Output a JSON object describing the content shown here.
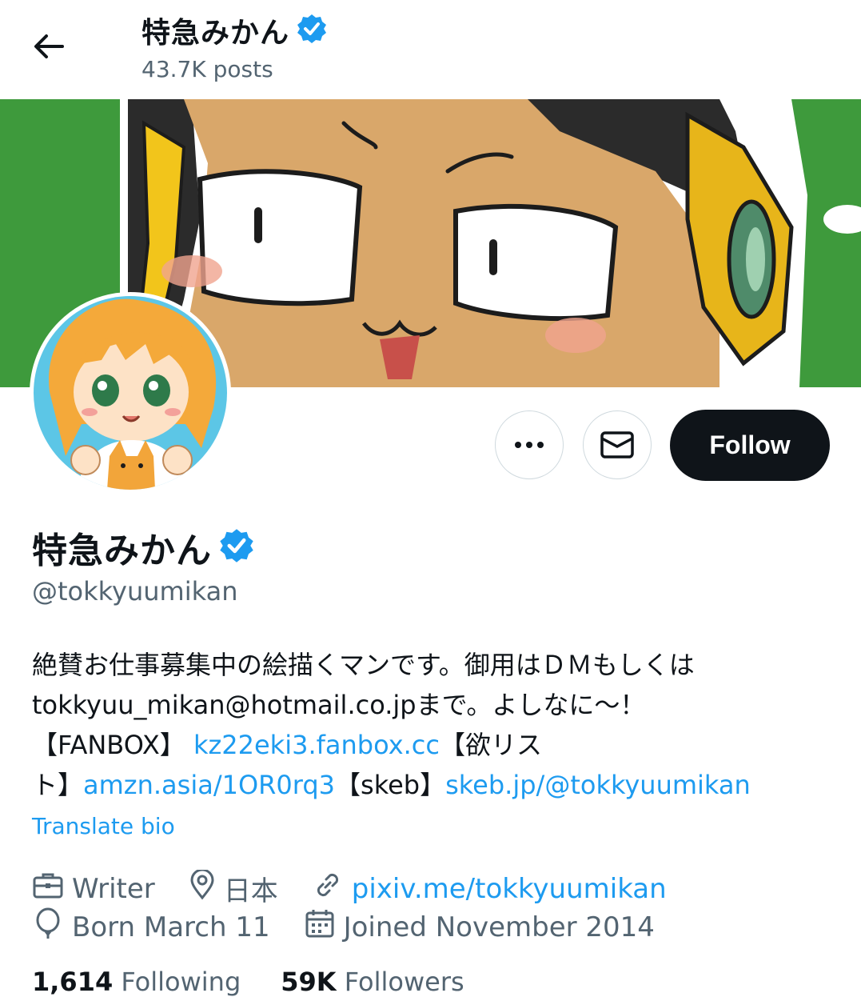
{
  "header": {
    "title": "特急みかん",
    "posts": "43.7K posts"
  },
  "actions": {
    "follow_label": "Follow"
  },
  "profile": {
    "name": "特急みかん",
    "handle": "@tokkyuumikan",
    "bio": {
      "line1": "絶賛お仕事募集中の絵描くマンです。御用はＤＭもしくは",
      "line2": "tokkyuu_mikan@hotmail.co.jpまで。よしなに～！",
      "fanbox_prefix": "【FANBOX】 ",
      "fanbox_link": "kz22eki3.fanbox.cc",
      "wishlist_prefix": "【欲リス",
      "wishlist_cont": "ト】",
      "wishlist_link": "amzn.asia/1OR0rq3",
      "skeb_prefix": "【skeb】",
      "skeb_link": "skeb.jp/@tokkyuumikan"
    },
    "translate_label": "Translate bio",
    "meta": {
      "category": "Writer",
      "location": "日本",
      "website": "pixiv.me/tokkyuumikan",
      "birthday": "Born March 11",
      "joined": "Joined November 2014"
    },
    "stats": {
      "following_count": "1,614",
      "following_label": "Following",
      "followers_count": "59K",
      "followers_label": "Followers"
    }
  },
  "colors": {
    "accent": "#1d9bf0",
    "banner_green": "#3e9a3c",
    "text": "#0f1419",
    "muted": "#536471"
  }
}
